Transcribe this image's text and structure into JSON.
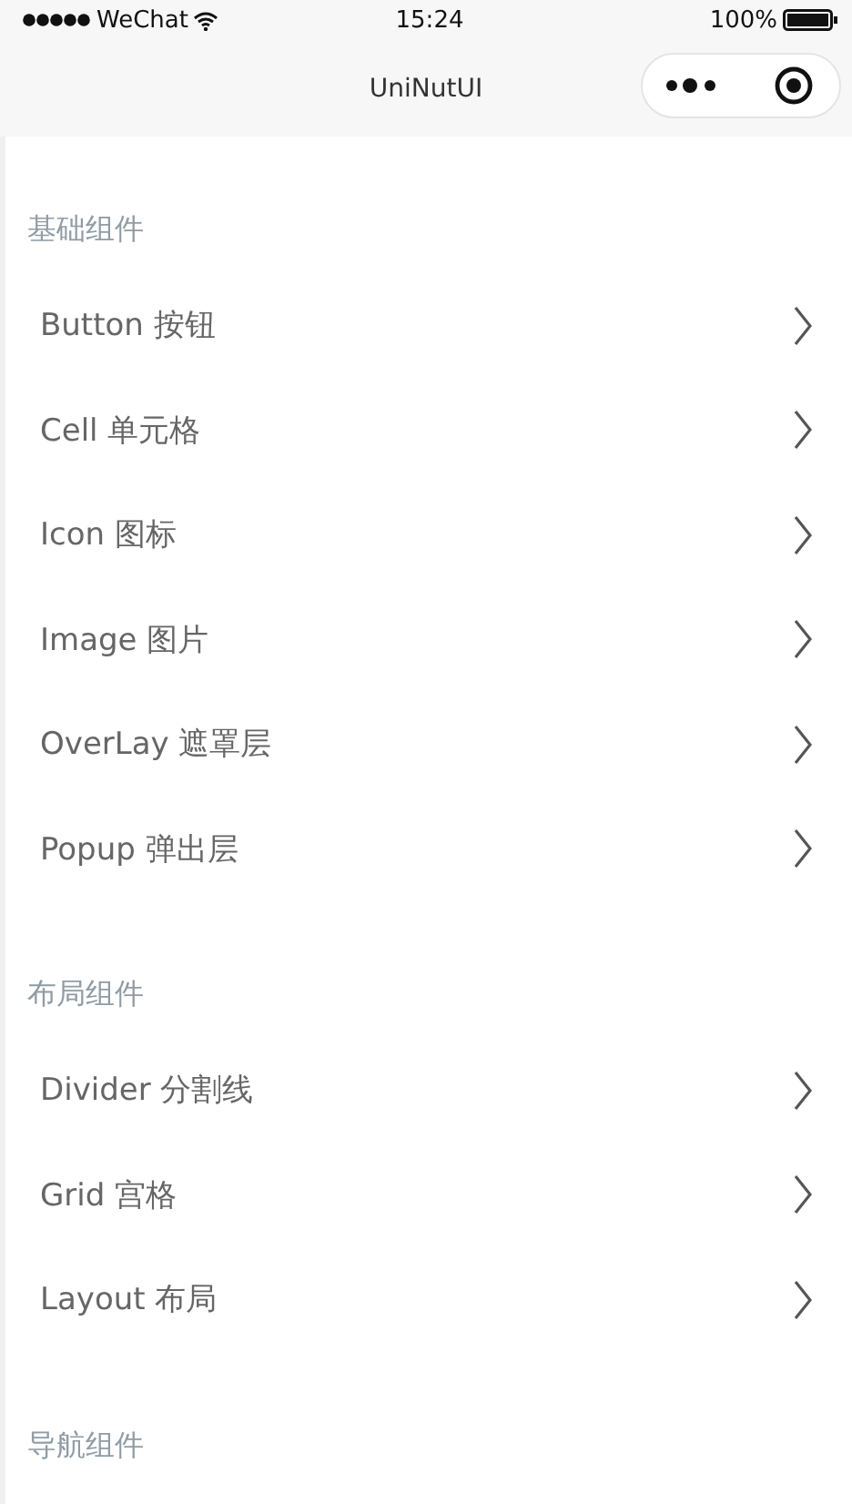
{
  "status_bar": {
    "carrier": "WeChat",
    "time": "15:24",
    "battery": "100%"
  },
  "nav_bar": {
    "title": "UniNutUI"
  },
  "sections": [
    {
      "title": "基础组件",
      "items": [
        "Button 按钮",
        "Cell 单元格",
        "Icon 图标",
        "Image 图片",
        "OverLay 遮罩层",
        "Popup 弹出层"
      ]
    },
    {
      "title": "布局组件",
      "items": [
        "Divider 分割线",
        "Grid 宫格",
        "Layout 布局"
      ]
    },
    {
      "title": "导航组件"
    }
  ]
}
